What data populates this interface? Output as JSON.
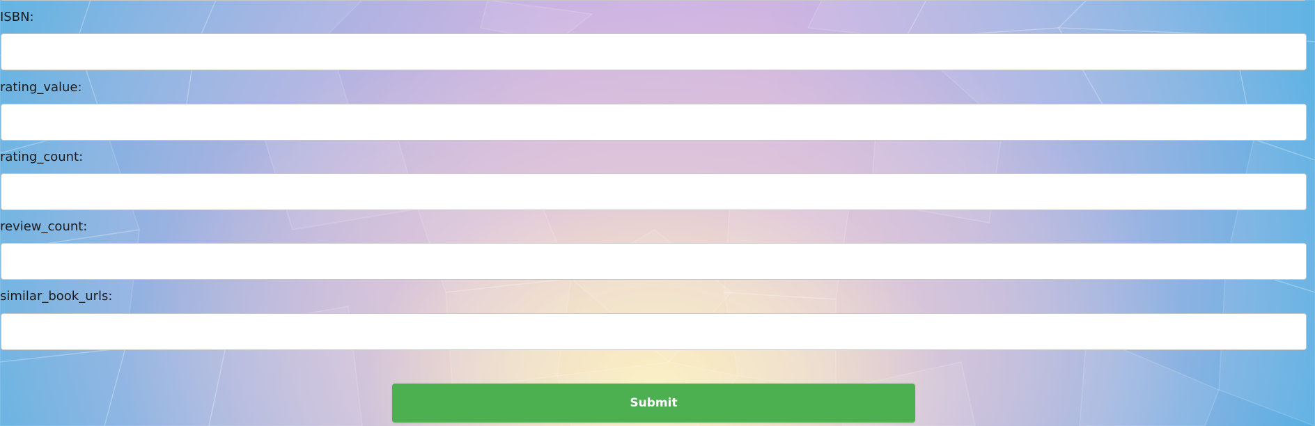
{
  "form": {
    "fields": [
      {
        "label": "ISBN:",
        "value": ""
      },
      {
        "label": "rating_value:",
        "value": ""
      },
      {
        "label": "rating_count:",
        "value": ""
      },
      {
        "label": "review_count:",
        "value": ""
      },
      {
        "label": "similar_book_urls:",
        "value": ""
      }
    ],
    "submit_label": "Submit"
  },
  "colors": {
    "submit_background": "#4caf50",
    "input_background": "#ffffff",
    "label_text": "#1b1b1b"
  }
}
